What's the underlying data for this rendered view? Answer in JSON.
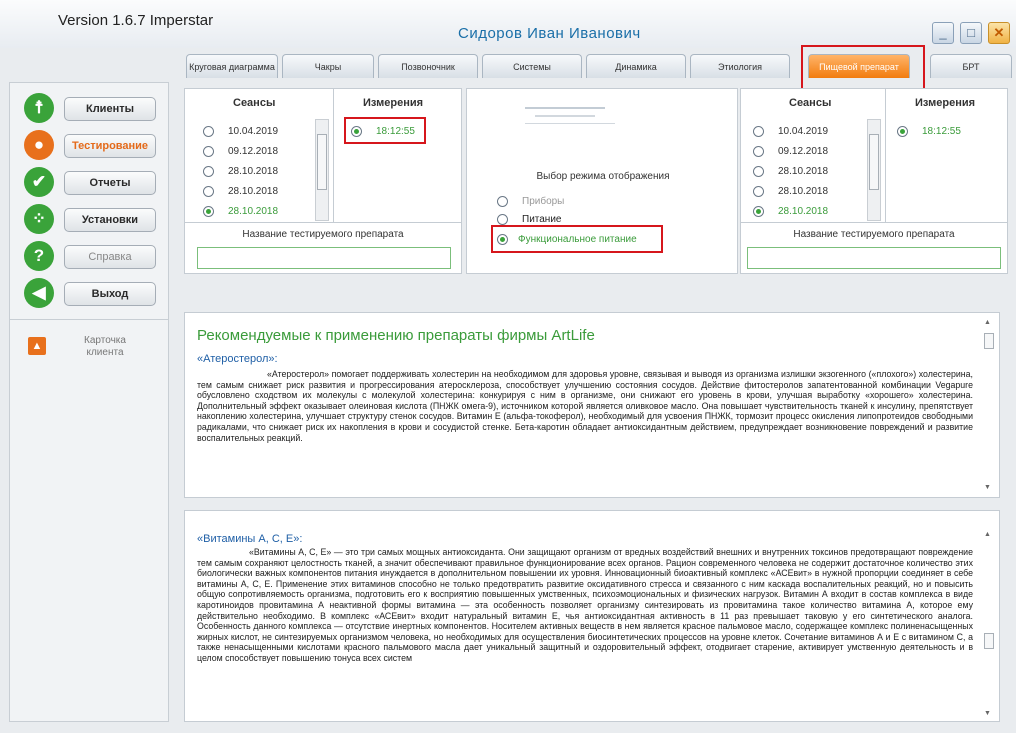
{
  "window": {
    "version": "Version 1.6.7 Imperstar",
    "user": "Сидоров Иван Иванович",
    "controls": [
      {
        "name": "minimize",
        "glyph": "_"
      },
      {
        "name": "maximize",
        "glyph": "□"
      },
      {
        "name": "close",
        "glyph": "✕"
      }
    ]
  },
  "tabs": [
    {
      "label": "Круговая диаграмма"
    },
    {
      "label": "Чакры"
    },
    {
      "label": "Позвоночник"
    },
    {
      "label": "Системы"
    },
    {
      "label": "Динамика"
    },
    {
      "label": "Этиология"
    },
    {
      "label": "Пищевой препарат",
      "active": true
    },
    {
      "label": "БРТ"
    }
  ],
  "sidebar": {
    "items": [
      {
        "label": "Клиенты",
        "icon": "person-icon",
        "color": "#3aa33a"
      },
      {
        "label": "Тестирование",
        "icon": "tester-icon",
        "color": "#e8701c"
      },
      {
        "label": "Отчеты",
        "icon": "check-icon",
        "color": "#3aa33a"
      },
      {
        "label": "Установки",
        "icon": "network-icon",
        "color": "#3aa33a"
      },
      {
        "label": "Справка",
        "icon": "question-icon",
        "color": "#3aa33a"
      },
      {
        "label": "Выход",
        "icon": "arrow-left-icon",
        "color": "#3aa33a"
      }
    ],
    "card": "Карточка клиента"
  },
  "left_panel": {
    "sessions_header": "Сеансы",
    "measures_header": "Измерения",
    "sessions": [
      "10.04.2019",
      "09.12.2018",
      "28.10.2018",
      "28.10.2018",
      "28.10.2018"
    ],
    "selected_session": 4,
    "measure": "18:12:55",
    "drug_label": "Название тестируемого препарата"
  },
  "center_panel": {
    "mode_title": "Выбор режима отображения",
    "modes": [
      "Приборы",
      "Питание",
      "Функциональное питание"
    ],
    "selected_mode": 2
  },
  "right_panel": {
    "sessions_header": "Сеансы",
    "measures_header": "Измерения",
    "sessions": [
      "10.04.2019",
      "09.12.2018",
      "28.10.2018",
      "28.10.2018",
      "28.10.2018"
    ],
    "selected_session": 4,
    "measure": "18:12:55",
    "drug_label": "Название тестируемого препарата"
  },
  "recommend": {
    "title": "Рекомендуемые к применению препараты фирмы ArtLife",
    "product": "«Атеростерол»:",
    "text": "«Атеростерол» помогает поддерживать холестерин на необходимом для здоровья уровне, связывая и выводя из организма излишки экзогенного («плохого») холестерина, тем самым снижает риск развития и прогрессирования атеросклероза, способствует улучшению состояния сосудов. Действие фитостеролов запатентованной комбинации Vegapure обусловлено сходством их молекулы с молекулой холестерина: конкурируя с ним в организме, они снижают его уровень в крови, улучшая выработку «хорошего» холестерина. Дополнительный эффект оказывает олеиновая кислота (ПНЖК омега-9), источником которой является оливковое масло. Она повышает чувствительность тканей к инсулину, препятствует накоплению холестерина, улучшает структуру стенок сосудов. Витамин Е (альфа-токоферол), необходимый для усвоения ПНЖК, тормозит процесс окисления липопротеидов свободными радикалами, что снижает риск их накопления в крови и сосудистой стенке. Бета-каротин обладает антиоксидантным действием, предупреждает возникновение повреждений и развитие воспалительных реакций."
  },
  "vitamins": {
    "product": "«Витамины А, С, Е»:",
    "text": "«Витамины А, С, Е» — это три самых мощных антиоксиданта. Они защищают организм от вредных воздействий внешних и внутренних токсинов предотвращают повреждение тем самым сохраняют целостность тканей, а значит обеспечивают правильное функционирование всех органов. Рацион современного человека не содержит достаточное количество этих биологически важных компонентов питания инуждается в дополнительном повышении их уровня. Инновационный биоактивный комплекс «АСЕвит» в нужной пропорции соединяет в себе витамины А, С, Е. Применение этих витаминов способно не только предотвратить развитие оксидативного стресса и связанного с ним каскада воспалительных реакций, но и повысить общую сопротивляемость организма, подготовить его к восприятию повышенных умственных, психоэмоциональных и физических нагрузок. Витамин А входит в состав комплекса в виде каротиноидов провитамина А неактивной формы витамина — эта особенность позволяет организму синтезировать из провитамина такое количество витамина А, которое ему действительно необходимо. В комплекс «АСЕвит» входит натуральный витамин Е, чья антиоксидантная активность в 11 раз превышает таковую у его синтетического аналога. Особенность данного комплекса — отсутствие инертных компонентов. Носителем активных веществ в нем является красное пальмовое масло, содержащее комплекс полиненасыщенных жирных кислот, не синтезируемых организмом человека, но необходимых для осуществления биосинтетических процессов на уровне клеток. Сочетание витаминов А и Е с витамином С, а также ненасыщенными кислотами красного пальмового масла дает уникальный защитный и оздоровительный эффект, отодвигает старение, активирует умственную деятельность и в целом способствует повышению тонуса всех систем"
  }
}
